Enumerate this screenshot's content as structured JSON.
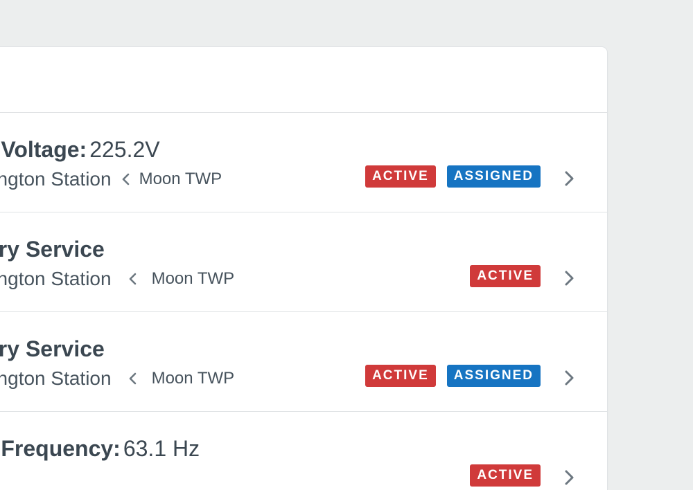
{
  "alerts": [
    {
      "prefix": "r Voltage:",
      "reading": "225.2V",
      "station": "rington Station",
      "location": "Moon TWP",
      "badges": [
        "ACTIVE",
        "ASSIGNED"
      ]
    },
    {
      "prefix": "ery Service",
      "reading": "",
      "station": "rington Station",
      "location": "Moon TWP",
      "badges": [
        "ACTIVE"
      ]
    },
    {
      "prefix": "ery Service",
      "reading": "",
      "station": "rington Station",
      "location": "Moon TWP",
      "badges": [
        "ACTIVE",
        "ASSIGNED"
      ]
    },
    {
      "prefix": "r Frequency:",
      "reading": "63.1 Hz",
      "station": "",
      "location": "",
      "badges": [
        "ACTIVE"
      ]
    }
  ],
  "icons": {
    "separator": "chevron-left-icon",
    "row_action": "chevron-right-icon"
  },
  "colors": {
    "active": "#d03a3a",
    "assigned": "#1674c2",
    "background": "#eceeee"
  }
}
